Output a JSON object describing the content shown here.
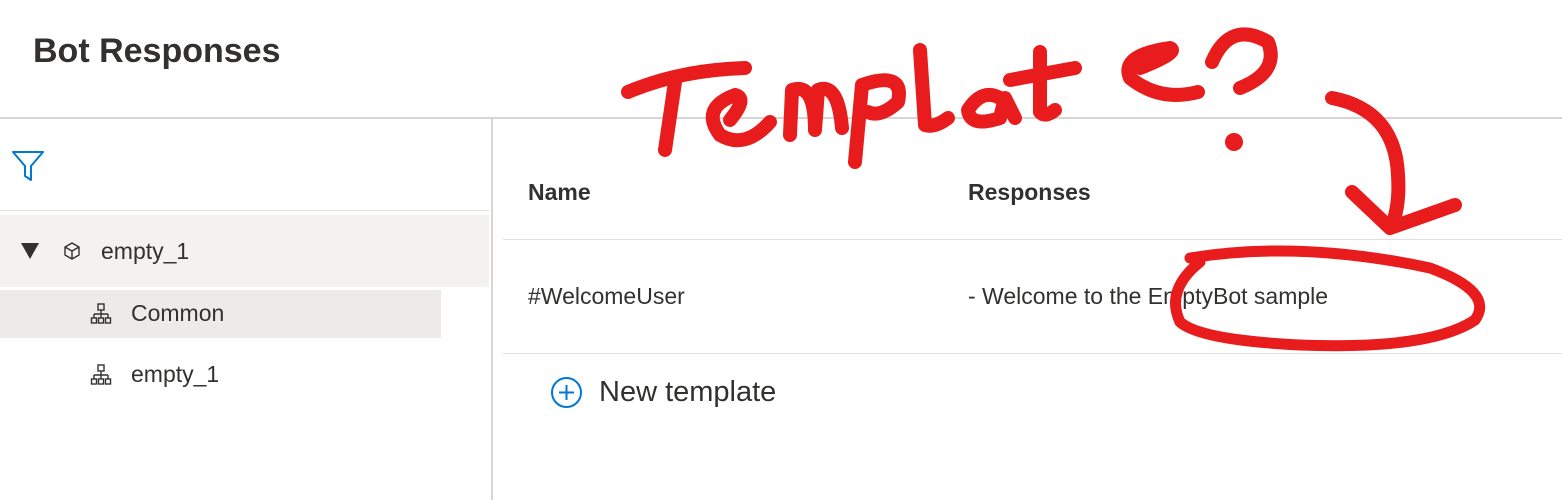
{
  "page": {
    "title": "Bot Responses"
  },
  "sidebar": {
    "filter_icon": "filter-icon",
    "tree": {
      "root": {
        "label": "empty_1",
        "expanded": true,
        "icon": "cube-icon"
      },
      "children": [
        {
          "label": "Common",
          "icon": "org-chart-icon",
          "selected": true
        },
        {
          "label": "empty_1",
          "icon": "org-chart-icon",
          "selected": false
        }
      ]
    }
  },
  "table": {
    "columns": [
      "Name",
      "Responses"
    ],
    "rows": [
      {
        "name": "#WelcomeUser",
        "response": "- Welcome to the EmptyBot sample"
      }
    ],
    "new_template_label": "New template"
  },
  "annotation": {
    "text": "Template?",
    "color": "#e81c1c"
  },
  "colors": {
    "accent": "#0078d4",
    "selected_bg": "#edebe9",
    "hover_bg": "#f3f2f1",
    "divider": "#d6d6d6"
  }
}
